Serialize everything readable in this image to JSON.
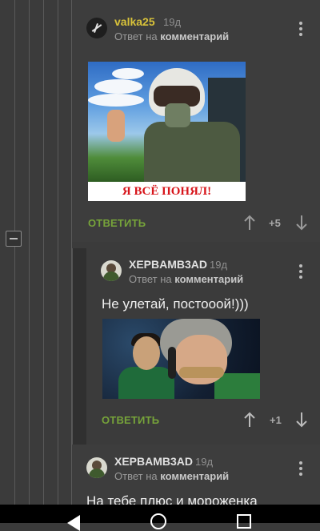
{
  "comments": [
    {
      "username": "valka25",
      "age": "19д",
      "reply_prefix": "Ответ на",
      "reply_target": "комментарий",
      "image_caption": "Я ВСЁ ПОНЯЛ!",
      "reply_label": "ОТВЕТИТЬ",
      "score": "+5"
    },
    {
      "username": "XEPBAMB3AD",
      "age": "19д",
      "reply_prefix": "Ответ на",
      "reply_target": "комментарий",
      "text": "Не улетай, постооой!)))",
      "reply_label": "ОТВЕТИТЬ",
      "score": "+1"
    },
    {
      "username": "XEPBAMB3AD",
      "age": "19д",
      "reply_prefix": "Ответ на",
      "reply_target": "комментарий",
      "text": "На тебе плюс и мороженка"
    }
  ],
  "icons": {
    "menu": "kebab-vertical-icon",
    "upvote": "arrow-up-icon",
    "downvote": "arrow-down-icon",
    "collapse": "minus-square-icon"
  },
  "colors": {
    "username_highlight": "#d8c23a",
    "reply_button": "#76a33a",
    "background": "#3b3b3b"
  }
}
